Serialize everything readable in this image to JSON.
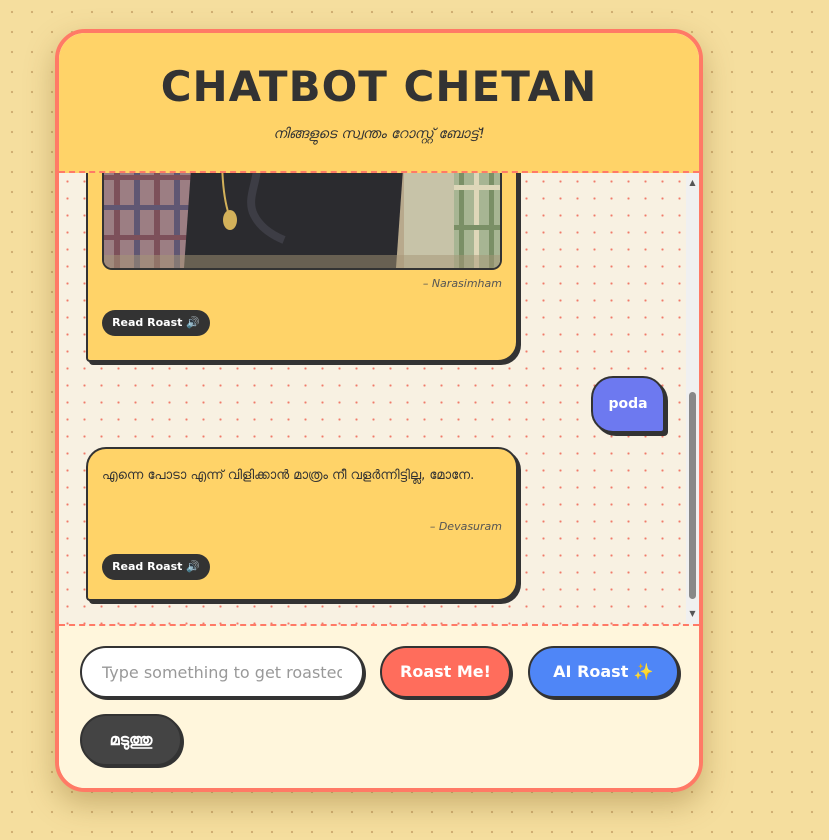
{
  "header": {
    "title": "CHATBOT CHETAN",
    "subtitle": "നിങ്ങളുടെ സ്വന്തം റോസ്റ്റ് ബോട്ട്!"
  },
  "messages": [
    {
      "type": "bot-image",
      "attribution": "– Narasimham",
      "read_label": "Read Roast",
      "read_icon": "speaker-icon"
    },
    {
      "type": "user",
      "text": "poda"
    },
    {
      "type": "bot-text",
      "text": "എന്നെ പോടാ എന്ന് വിളിക്കാൻ മാത്രം നീ വളർന്നിട്ടില്ല, മോനേ.",
      "attribution": "– Devasuram",
      "read_label": "Read Roast",
      "read_icon": "speaker-icon"
    }
  ],
  "input": {
    "placeholder": "Type something to get roasted",
    "value": ""
  },
  "buttons": {
    "roast": "Roast Me!",
    "ai_roast": "AI Roast ✨",
    "clear": "മടുത്തു"
  },
  "icons": {
    "speaker": "🔊",
    "scroll_up": "▲",
    "scroll_down": "▼"
  },
  "colors": {
    "accent": "#ff7a66",
    "header_bg": "#ffd368",
    "bot_bubble": "#ffd368",
    "user_bubble": "#6d79f0",
    "roast_button": "#ff6d5c",
    "ai_button": "#4f86f7",
    "clear_button": "#444444"
  }
}
